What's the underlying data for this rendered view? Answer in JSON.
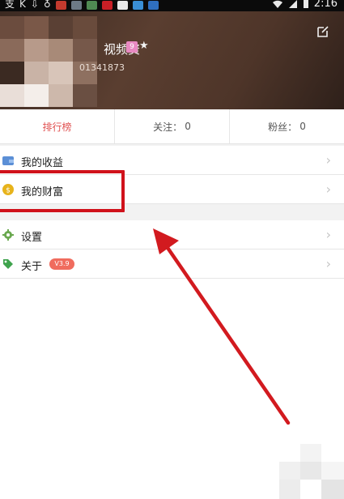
{
  "status_bar": {
    "left_glyphs": [
      "支",
      "K",
      "⇩",
      "♁"
    ],
    "icons": [
      "camera-app-icon",
      "phone-app-icon",
      "gallery-app-icon",
      "news-app-icon",
      "baidu-app-icon",
      "shop-app-icon",
      "wifi-app-icon"
    ],
    "time": "2:16"
  },
  "profile": {
    "username": "视频资",
    "level": "9",
    "user_id": "01341873"
  },
  "stats": {
    "ranking": "排行榜",
    "following_label": "关注：",
    "following_count": "0",
    "fans_label": "粉丝：",
    "fans_count": "0"
  },
  "menu": {
    "earnings": "我的收益",
    "wealth": "我的财富",
    "settings": "设置",
    "about": "关于",
    "version": "V3.9"
  },
  "colors": {
    "accent_red": "#e05050",
    "annotation_red": "#d0121b",
    "header_brown": "#4e3529",
    "version_badge": "#f06c5e"
  }
}
